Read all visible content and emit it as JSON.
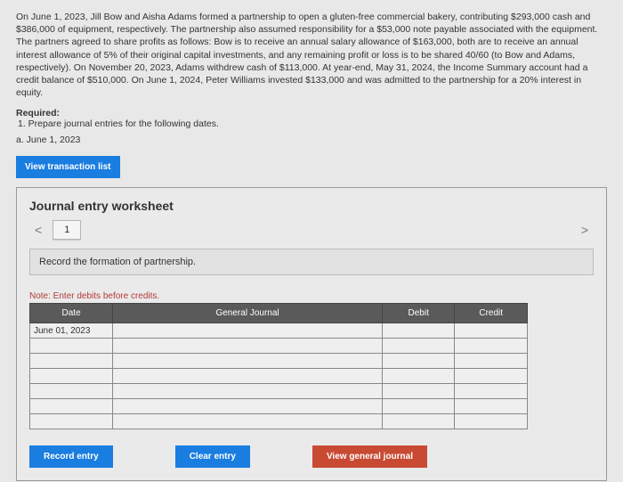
{
  "problem_text": "On June 1, 2023, Jill Bow and Aisha Adams formed a partnership to open a gluten-free commercial bakery, contributing $293,000 cash and $386,000 of equipment, respectively. The partnership also assumed responsibility for a $53,000 note payable associated with the equipment. The partners agreed to share profits as follows: Bow is to receive an annual salary allowance of $163,000, both are to receive an annual interest allowance of 5% of their original capital investments, and any remaining profit or loss is to be shared 40/60 (to Bow and Adams, respectively). On November 20, 2023, Adams withdrew cash of $113,000. At year-end, May 31, 2024, the Income Summary account had a credit balance of $510,000. On June 1, 2024, Peter Williams invested $133,000 and was admitted to the partnership for a 20% interest in equity.",
  "required": {
    "label": "Required:",
    "item1": "1. Prepare journal entries for the following dates.",
    "sub_a": "a. June 1, 2023"
  },
  "vtl_button": "View transaction list",
  "worksheet": {
    "title": "Journal entry worksheet",
    "prev": "<",
    "next": ">",
    "tab1": "1",
    "instruction": "Record the formation of partnership.",
    "note": "Note: Enter debits before credits.",
    "headers": {
      "date": "Date",
      "gj": "General Journal",
      "debit": "Debit",
      "credit": "Credit"
    },
    "date_value": "June 01, 2023"
  },
  "buttons": {
    "record": "Record entry",
    "clear": "Clear entry",
    "view_gj": "View general journal"
  }
}
